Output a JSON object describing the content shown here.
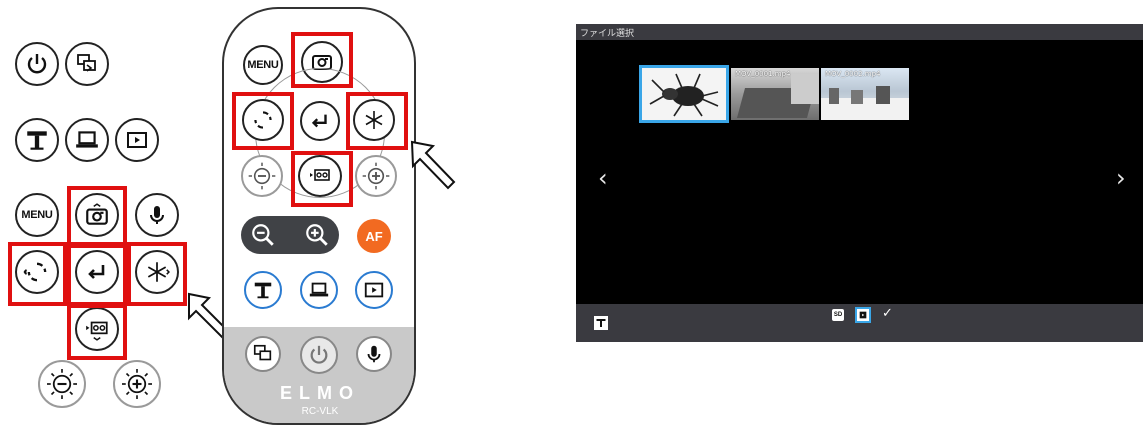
{
  "left_panel": {
    "menu_label": "MENU"
  },
  "remote": {
    "menu_label": "MENU",
    "af_label": "AF",
    "brand": "ELMO",
    "model": "RC-VLK"
  },
  "screen": {
    "title": "ファイル選択",
    "thumbnails": [
      {
        "label": "",
        "selected": true
      },
      {
        "label": "MOV_0001.mp4",
        "selected": false
      },
      {
        "label": "MOV_0002.mp4",
        "selected": false
      }
    ],
    "prev_arrow": "‹",
    "next_arrow": "›",
    "bottom_left_icon": "camera-mode-icon",
    "bottom_icons": [
      "sd-card-icon",
      "usb-memory-icon",
      "check-icon"
    ],
    "sd_label": "SD",
    "check_label": "✓"
  },
  "colors": {
    "highlight_red": "#e01010",
    "selection_blue": "#3aa6e8",
    "af_orange": "#f26a21",
    "remote_grey": "#c9c9c9",
    "screen_bg": "#000000",
    "screen_bar": "#3a3a40"
  }
}
